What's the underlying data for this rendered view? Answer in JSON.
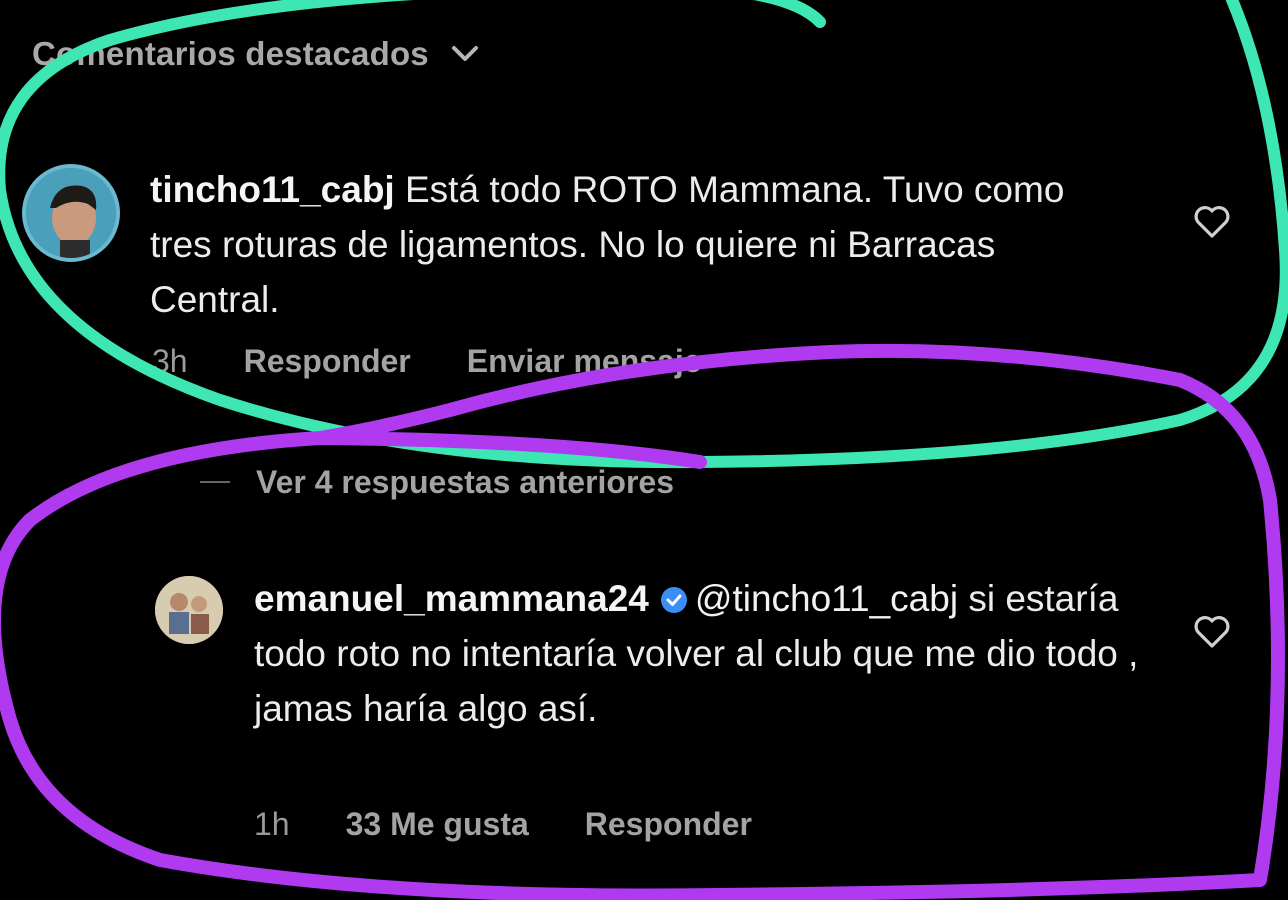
{
  "header": {
    "title": "Comentarios destacados",
    "chevron_icon": "chevron-down-icon"
  },
  "comments": [
    {
      "username": "tincho11_cabj",
      "text": "Está todo ROTO Mammana. Tuvo como tres roturas de ligamentos. No lo quiere ni Barracas Central.",
      "time": "3h",
      "reply_label": "Responder",
      "message_label": "Enviar mensaje",
      "heart_icon": "heart-outline-icon"
    },
    {
      "username": "emanuel_mammana24",
      "verified": true,
      "mention": "@tincho11_cabj",
      "text": "si estaría todo roto no intentaría volver al club que me dio todo , jamas haría algo así.",
      "time": "1h",
      "likes_label": "33 Me gusta",
      "reply_label": "Responder",
      "heart_icon": "heart-outline-icon"
    }
  ],
  "replies_link": {
    "label": "Ver 4 respuestas anteriores"
  },
  "annotations": {
    "circle1_color": "#3ee6b4",
    "circle2_color": "#b03af0"
  }
}
